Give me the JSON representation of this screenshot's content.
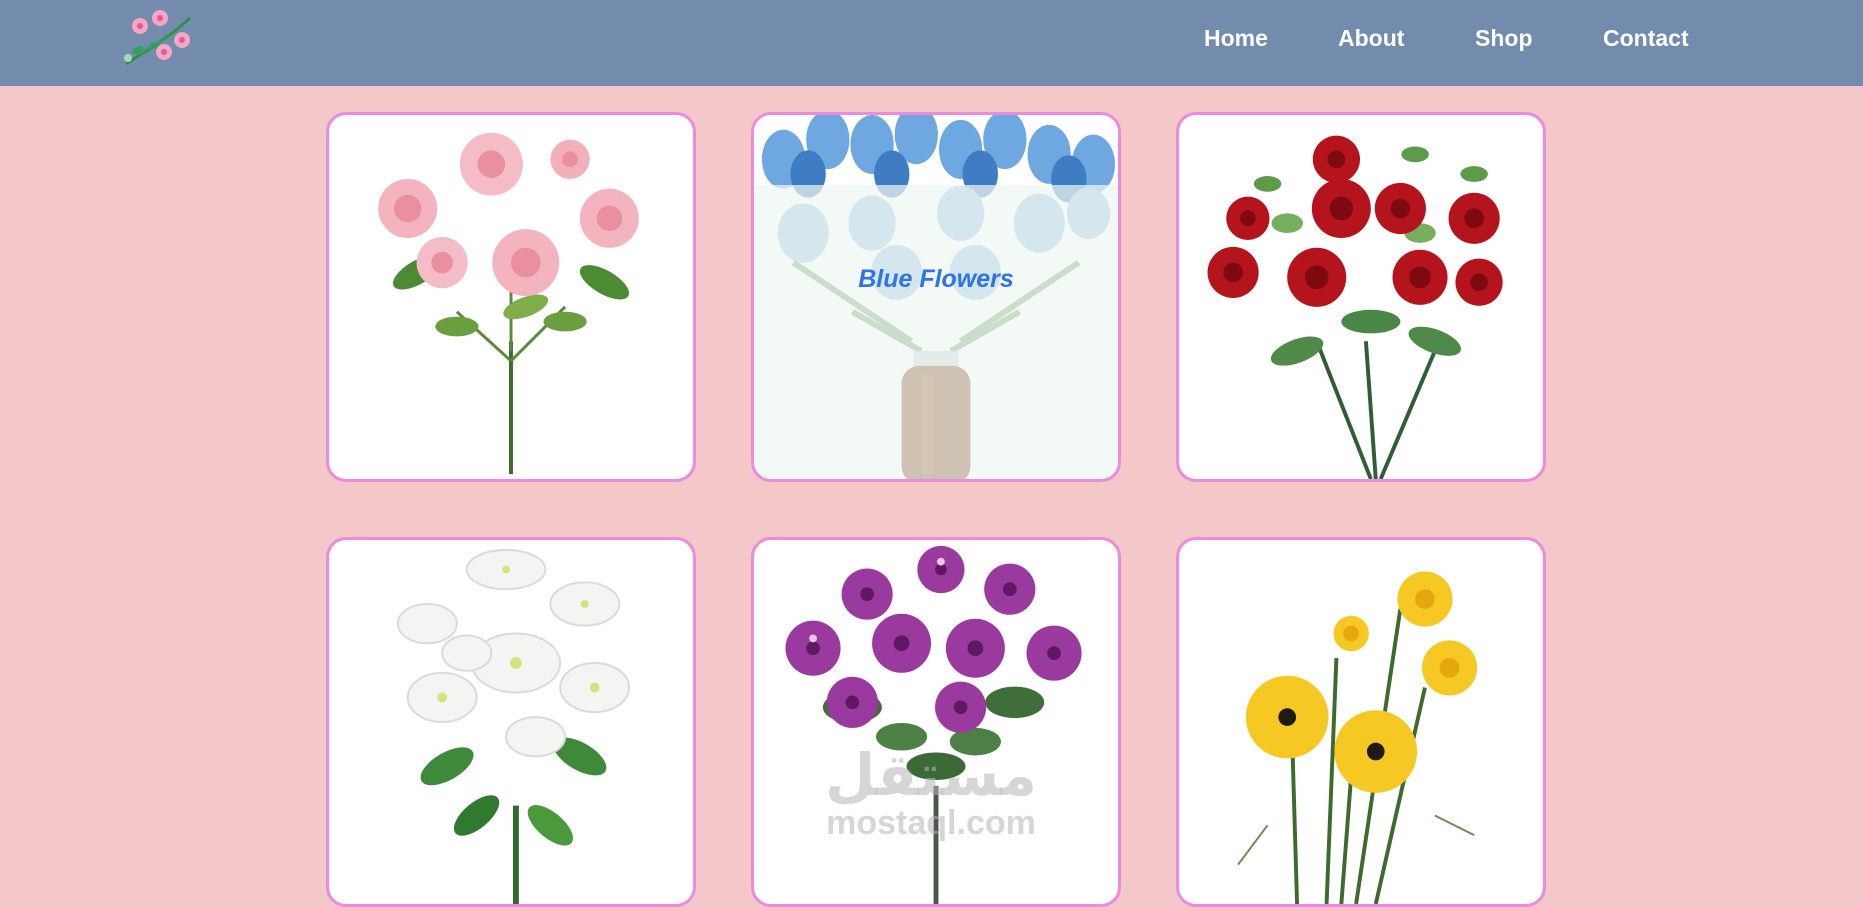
{
  "nav": {
    "links": [
      "Home",
      "About",
      "Shop",
      "Contact"
    ]
  },
  "cards": [
    {
      "name": "pink-roses",
      "caption": ""
    },
    {
      "name": "blue-tulips",
      "caption": "Blue Flowers"
    },
    {
      "name": "red-roses",
      "caption": ""
    },
    {
      "name": "white-lilies",
      "caption": ""
    },
    {
      "name": "purple-petunias",
      "caption": ""
    },
    {
      "name": "yellow-daisies",
      "caption": ""
    }
  ],
  "watermark": {
    "arabic": "مستقل",
    "latin": "mostaql.com"
  },
  "colors": {
    "navbar": "#738cae",
    "background": "#f4c7c9",
    "card_border": "#ea8be0",
    "caption": "#2f73ea"
  }
}
